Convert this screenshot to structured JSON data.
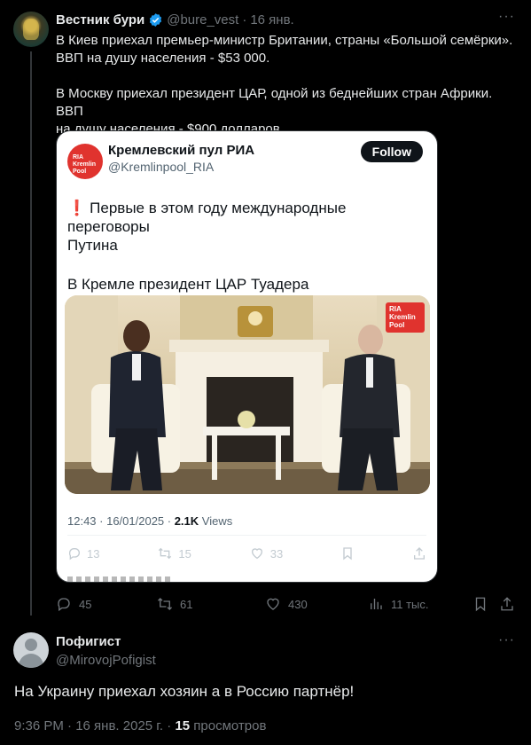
{
  "tweet": {
    "author_name": "Вестник бури",
    "handle": "@bure_vest",
    "date": "16 янв.",
    "separator": "·",
    "more": "···",
    "lines": [
      "В Киев приехал премьер-министр Британии, страны «Большой семёрки».",
      "ВВП на душу населения - $53 000.",
      "",
      "В Москву приехал президент ЦАР, одной из беднейших стран Африки. ВВП",
      "на душу населения - $900 долларов."
    ],
    "actions": {
      "replies": "45",
      "reposts": "61",
      "likes": "430",
      "views": "11 тыс."
    }
  },
  "quote": {
    "avatar_text": "RIA Kremlin Pool",
    "author_name": "Кремлевский пул РИА",
    "handle": "@Kremlinpool_RIA",
    "follow_label": "Follow",
    "exclamation": "❗",
    "line1": "Первые в этом году международные переговоры",
    "line2": "Путина",
    "line3": "В Кремле президент ЦАР Туадера",
    "image_watermark": "RIA Kremlin Pool",
    "time": "12:43 · 16/01/2025 · ",
    "views_count": "2.1K",
    "views_label": " Views",
    "actions": {
      "replies": "13",
      "reposts": "15",
      "likes": "33"
    }
  },
  "reply": {
    "author_name": "Пофигист",
    "handle": "@MirovojPofigist",
    "more": "···",
    "text": "На Украину приехал хозяин а в Россию партнёр!",
    "meta_prefix": "9:36 PM · 16 янв. 2025 г. · ",
    "views_count": "15",
    "views_label": " просмотров"
  },
  "colors": {
    "background": "#000000",
    "text_primary": "#e7e9ea",
    "text_secondary": "#71767b",
    "verified": "#1d9bf0",
    "ria_red": "#e0332e"
  }
}
